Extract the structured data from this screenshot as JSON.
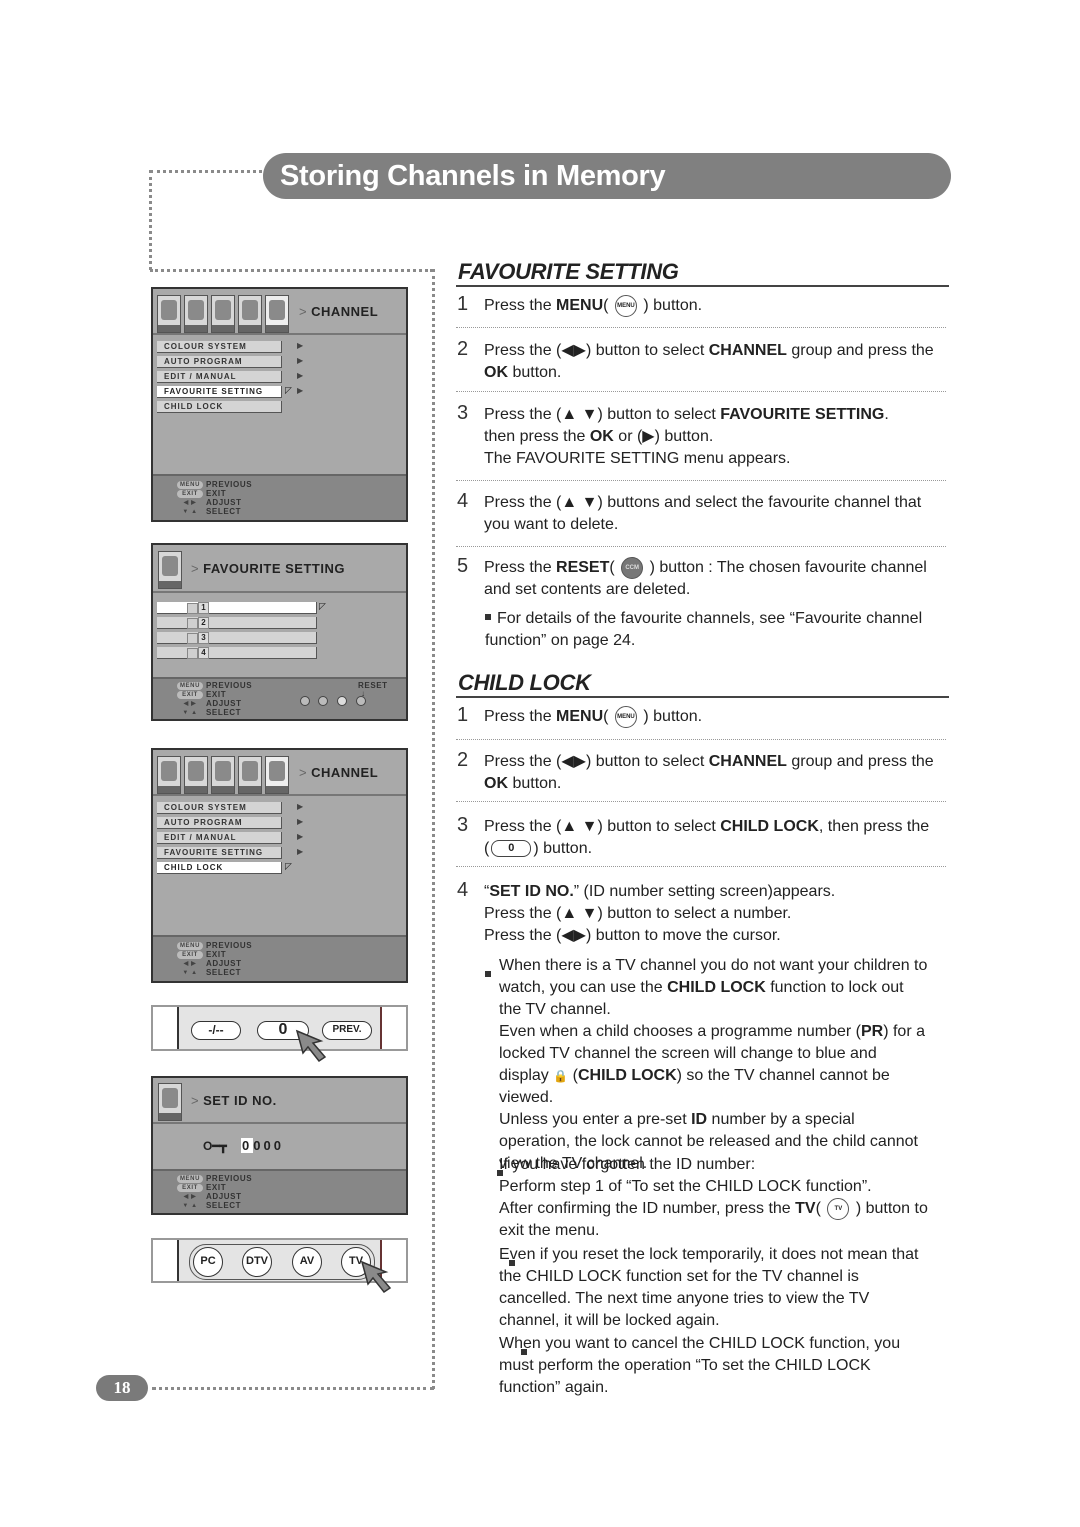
{
  "header": {
    "title": "Storing Channels in Memory"
  },
  "page_number": "18",
  "favourite_setting": {
    "heading": "FAVOURITE SETTING",
    "steps": [
      {
        "num": "1",
        "parts": [
          {
            "t": "Press the "
          },
          {
            "t": "MENU",
            "b": true
          },
          {
            "t": "( "
          },
          {
            "icon": "menu"
          },
          {
            "t": " ) button."
          }
        ]
      },
      {
        "num": "2",
        "parts": [
          {
            "t": "Press the (◀▶) button to select "
          },
          {
            "t": "CHANNEL",
            "b": true
          },
          {
            "t": " group and press the "
          },
          {
            "t": "OK",
            "b": true
          },
          {
            "t": " button."
          }
        ]
      },
      {
        "num": "3",
        "parts": [
          {
            "t": "Press the (▲ ▼) button to select "
          },
          {
            "t": "FAVOURITE SETTING",
            "b": true
          },
          {
            "t": "."
          },
          {
            "br": true
          },
          {
            "t": "then press the "
          },
          {
            "t": "OK",
            "b": true
          },
          {
            "t": " or (▶) button."
          },
          {
            "br": true
          },
          {
            "t": "The FAVOURITE SETTING menu appears."
          }
        ]
      },
      {
        "num": "4",
        "parts": [
          {
            "t": "Press the (▲ ▼) buttons and select the favourite channel that you want to delete."
          }
        ]
      },
      {
        "num": "5",
        "parts": [
          {
            "t": "Press the "
          },
          {
            "t": "RESET",
            "b": true
          },
          {
            "t": "( "
          },
          {
            "icon": "reset"
          },
          {
            "t": " ) button : The chosen favourite channel and set contents are deleted."
          }
        ]
      }
    ],
    "note": "For details of the favourite channels, see “Favourite channel function” on page 24."
  },
  "child_lock": {
    "heading": "CHILD LOCK",
    "steps": [
      {
        "num": "1",
        "parts": [
          {
            "t": "Press the "
          },
          {
            "t": "MENU",
            "b": true
          },
          {
            "t": "( "
          },
          {
            "icon": "menu"
          },
          {
            "t": " ) button."
          }
        ]
      },
      {
        "num": "2",
        "parts": [
          {
            "t": "Press the (◀▶) button to select "
          },
          {
            "t": "CHANNEL",
            "b": true
          },
          {
            "t": " group and press the "
          },
          {
            "t": "OK",
            "b": true
          },
          {
            "t": " button."
          }
        ]
      },
      {
        "num": "3",
        "parts": [
          {
            "t": "Press the (▲ ▼) button to select "
          },
          {
            "t": "CHILD LOCK",
            "b": true
          },
          {
            "t": ", then press the ("
          },
          {
            "icon": "zero"
          },
          {
            "t": ") button."
          }
        ]
      },
      {
        "num": "4",
        "parts": [
          {
            "t": "“"
          },
          {
            "t": "SET ID NO.",
            "b": true
          },
          {
            "t": "” (ID number setting screen)appears."
          },
          {
            "br": true
          },
          {
            "t": "Press the (▲ ▼) button to select a number."
          },
          {
            "br": true
          },
          {
            "t": "Press the (◀▶) button to move the cursor."
          }
        ]
      }
    ],
    "notes": [
      [
        {
          "t": "When there is a TV channel you do not want your children to watch, you can use the "
        },
        {
          "t": "CHILD LOCK",
          "b": true
        },
        {
          "t": " function to lock out the TV channel."
        },
        {
          "br": true
        },
        {
          "t": "Even when a child chooses a programme number ("
        },
        {
          "t": "PR",
          "b": true
        },
        {
          "t": ") for a locked TV channel the screen will change to blue and display "
        },
        {
          "icon": "lock"
        },
        {
          "t": " ("
        },
        {
          "t": "CHILD LOCK",
          "b": true
        },
        {
          "t": ") so the TV channel cannot be viewed."
        },
        {
          "br": true
        },
        {
          "t": "Unless you enter a pre-set "
        },
        {
          "t": "ID",
          "b": true
        },
        {
          "t": " number by a special operation, the lock cannot be released and the child cannot view the TV channel."
        }
      ],
      [
        {
          "t": "If you have forgotten the ID number:"
        },
        {
          "br": true
        },
        {
          "t": "Perform step 1 of “To set the CHILD LOCK function”."
        },
        {
          "br": true
        },
        {
          "t": "After confirming the ID number, press the "
        },
        {
          "t": "TV",
          "b": true
        },
        {
          "t": "( "
        },
        {
          "icon": "tv"
        },
        {
          "t": " ) button to exit the menu."
        }
      ],
      [
        {
          "t": "Even if you reset the lock temporarily, it does not mean that the CHILD LOCK function set for the TV channel is cancelled. The next time anyone tries to view the TV channel, it will be locked again."
        }
      ],
      [
        {
          "t": "When you want to cancel the CHILD LOCK function, you must perform the operation “To set the CHILD LOCK function” again."
        }
      ]
    ]
  },
  "osd": {
    "channel_crumb": "CHANNEL",
    "channel_menu": [
      "COLOUR SYSTEM",
      "AUTO PROGRAM",
      "EDIT / MANUAL",
      "FAVOURITE SETTING",
      "CHILD LOCK"
    ],
    "footer": {
      "menu_key": "MENU",
      "exit_key": "EXIT",
      "previous": "PREVIOUS",
      "exit": "EXIT",
      "adjust": "ADJUST",
      "select": "SELECT",
      "lr_keys": "◀ ▶",
      "ud_keys": "▼ ▲"
    },
    "favourite_crumb": "FAVOURITE SETTING",
    "favourite_slots": [
      "1",
      "2",
      "3",
      "4"
    ],
    "reset_label": "RESET",
    "setid_crumb": "SET ID NO.",
    "id_digits": [
      "0",
      "0",
      "0",
      "0"
    ],
    "key_icon": "O━┳"
  },
  "remote1": {
    "buttons": [
      "-/--",
      "0",
      "PREV."
    ]
  },
  "remote2": {
    "buttons": [
      "PC",
      "DTV",
      "AV",
      "TV"
    ]
  },
  "icons": {
    "menu": "MENU",
    "reset": "CCM",
    "zero": "0",
    "tv": "TV",
    "lock": "🔒"
  }
}
